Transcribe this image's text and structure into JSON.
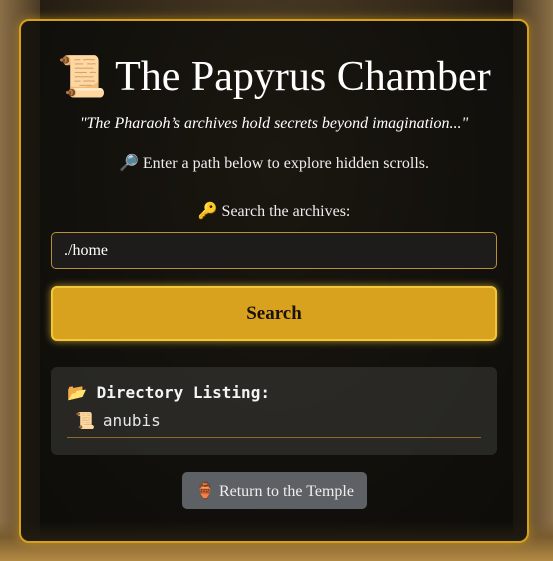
{
  "header": {
    "icon": "📜",
    "title": "The Papyrus Chamber",
    "quote": "\"The Pharaoh’s archives hold secrets beyond imagination...\""
  },
  "instruction": {
    "icon": "🔎",
    "text": "Enter a path below to explore hidden scrolls."
  },
  "search": {
    "icon": "🔑",
    "label": "Search the archives:",
    "value": "./home",
    "button_label": "Search"
  },
  "listing": {
    "icon": "📂",
    "heading": "Directory Listing:",
    "items": [
      {
        "icon": "📜",
        "name": "anubis"
      }
    ]
  },
  "footer": {
    "icon": "🏺",
    "return_label": "Return to the Temple"
  },
  "colors": {
    "accent": "#d9a21e",
    "panel_border": "#d6a21e",
    "secondary_button": "#5d6166"
  }
}
